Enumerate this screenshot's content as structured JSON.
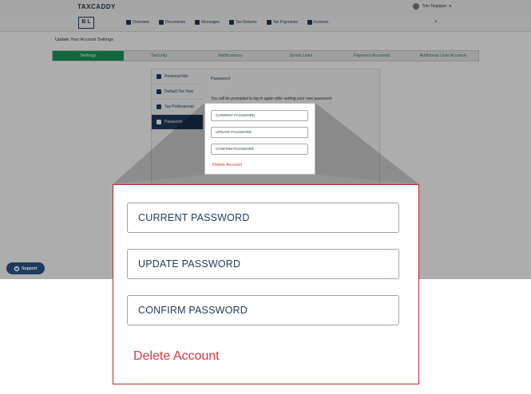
{
  "header": {
    "logo_text": "TAXCADDY",
    "brand_mark": "B L",
    "user_name": "Tom Taxpayer"
  },
  "nav": {
    "items": [
      {
        "label": "Overview",
        "icon": "home-icon"
      },
      {
        "label": "Documents",
        "icon": "documents-icon"
      },
      {
        "label": "Messages",
        "icon": "messages-icon"
      },
      {
        "label": "Tax Returns",
        "icon": "tax-returns-icon"
      },
      {
        "label": "Tax Payments",
        "icon": "tax-payments-icon"
      },
      {
        "label": "Invoices",
        "icon": "invoices-icon"
      }
    ],
    "search_icon": "search-icon"
  },
  "page": {
    "title": "Update Your Account Settings"
  },
  "tabs": [
    {
      "label": "Settings",
      "active": true
    },
    {
      "label": "Security",
      "active": false
    },
    {
      "label": "Notifications",
      "active": false
    },
    {
      "label": "Smart Links",
      "active": false
    },
    {
      "label": "Payment Accounts",
      "active": false
    },
    {
      "label": "Additional User Account",
      "active": false
    }
  ],
  "side_menu": [
    {
      "label": "Personal Info",
      "icon": "person-icon",
      "active": false
    },
    {
      "label": "Default Tax Year",
      "icon": "calendar-icon",
      "active": false
    },
    {
      "label": "Tax Professional",
      "icon": "briefcase-icon",
      "active": false
    },
    {
      "label": "Password",
      "icon": "lock-icon",
      "active": true
    }
  ],
  "password_section": {
    "title": "Password",
    "note": "You will be prompted to log in again after setting your new password.",
    "fields": {
      "current": "CURRENT PASSWORD",
      "update": "UPDATE PASSWORD",
      "confirm": "CONFIRM PASSWORD"
    },
    "delete_label": "Delete Account"
  },
  "support": {
    "label": "Support"
  },
  "colors": {
    "brand_navy": "#1f3a5f",
    "active_green": "#1a9a5c",
    "delete_red": "#d9363e",
    "highlight_border": "#c0262d"
  }
}
